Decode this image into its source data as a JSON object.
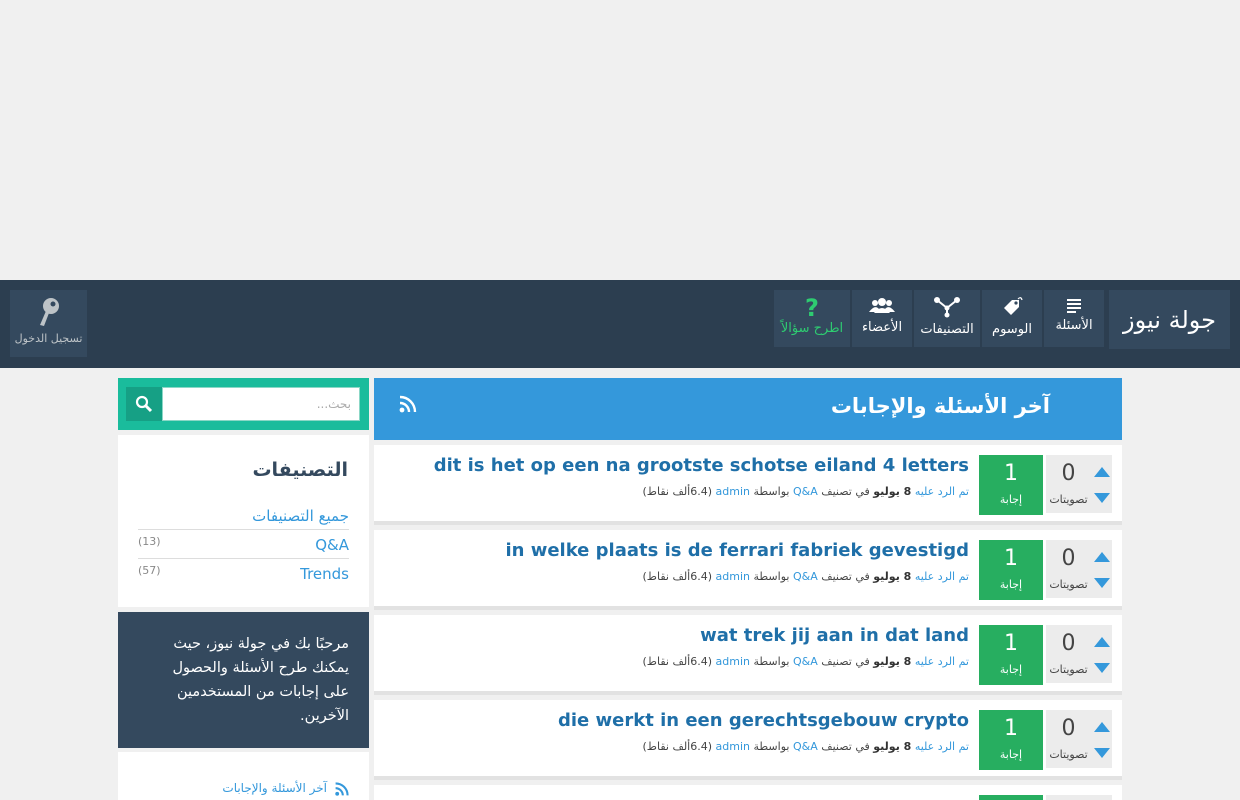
{
  "brand": {
    "logo_text": "جولة نيوز"
  },
  "nav": {
    "items": [
      {
        "label": "الأسئلة",
        "icon": "list-icon"
      },
      {
        "label": "الوسوم",
        "icon": "tag-icon"
      },
      {
        "label": "التصنيفات",
        "icon": "categories-icon"
      },
      {
        "label": "الأعضاء",
        "icon": "users-icon"
      }
    ],
    "ask": {
      "label": "اطرح سؤالاً",
      "symbol": "?"
    },
    "login": {
      "label": "تسجيل الدخول",
      "icon": "key-icon"
    }
  },
  "main": {
    "title": "آخر الأسئلة والإجابات",
    "questions": [
      {
        "title": "dit is het op een na grootste schotse eiland 4 letters",
        "votes": "0",
        "votes_label": "تصويتات",
        "answers": "1",
        "answers_label": "إجابة",
        "meta_answered": "تم الرد عليه",
        "meta_date": "8 يوليو",
        "meta_in": "في تصنيف",
        "meta_category": "Q&A",
        "meta_by": "بواسطة",
        "meta_user": "admin",
        "meta_points": "(6.4ألف نقاط)"
      },
      {
        "title": "in welke plaats is de ferrari fabriek gevestigd",
        "votes": "0",
        "votes_label": "تصويتات",
        "answers": "1",
        "answers_label": "إجابة",
        "meta_answered": "تم الرد عليه",
        "meta_date": "8 يوليو",
        "meta_in": "في تصنيف",
        "meta_category": "Q&A",
        "meta_by": "بواسطة",
        "meta_user": "admin",
        "meta_points": "(6.4ألف نقاط)"
      },
      {
        "title": "wat trek jij aan in dat land",
        "votes": "0",
        "votes_label": "تصويتات",
        "answers": "1",
        "answers_label": "إجابة",
        "meta_answered": "تم الرد عليه",
        "meta_date": "8 يوليو",
        "meta_in": "في تصنيف",
        "meta_category": "Q&A",
        "meta_by": "بواسطة",
        "meta_user": "admin",
        "meta_points": "(6.4ألف نقاط)"
      },
      {
        "title": "die werkt in een gerechtsgebouw crypto",
        "votes": "0",
        "votes_label": "تصويتات",
        "answers": "1",
        "answers_label": "إجابة",
        "meta_answered": "تم الرد عليه",
        "meta_date": "8 يوليو",
        "meta_in": "في تصنيف",
        "meta_category": "Q&A",
        "meta_by": "بواسطة",
        "meta_user": "admin",
        "meta_points": "(6.4ألف نقاط)"
      }
    ]
  },
  "sidebar": {
    "search": {
      "placeholder": "بحث..."
    },
    "categories": {
      "title": "التصنيفات",
      "items": [
        {
          "name": "جميع التصنيفات",
          "count": ""
        },
        {
          "name": "Q&A",
          "count": "(13)"
        },
        {
          "name": "Trends",
          "count": "(57)"
        }
      ]
    },
    "welcome": "مرحبًا بك في جولة نيوز، حيث يمكنك طرح الأسئلة والحصول على إجابات من المستخدمين الآخرين.",
    "feed": {
      "label": "آخر الأسئلة والإجابات"
    }
  },
  "colors": {
    "nav_bg": "#2c3e50",
    "nav_item_bg": "#34495e",
    "accent_blue": "#3498db",
    "answer_green": "#27ae60",
    "search_teal": "#1abc9c",
    "ask_green": "#2ecc71"
  }
}
